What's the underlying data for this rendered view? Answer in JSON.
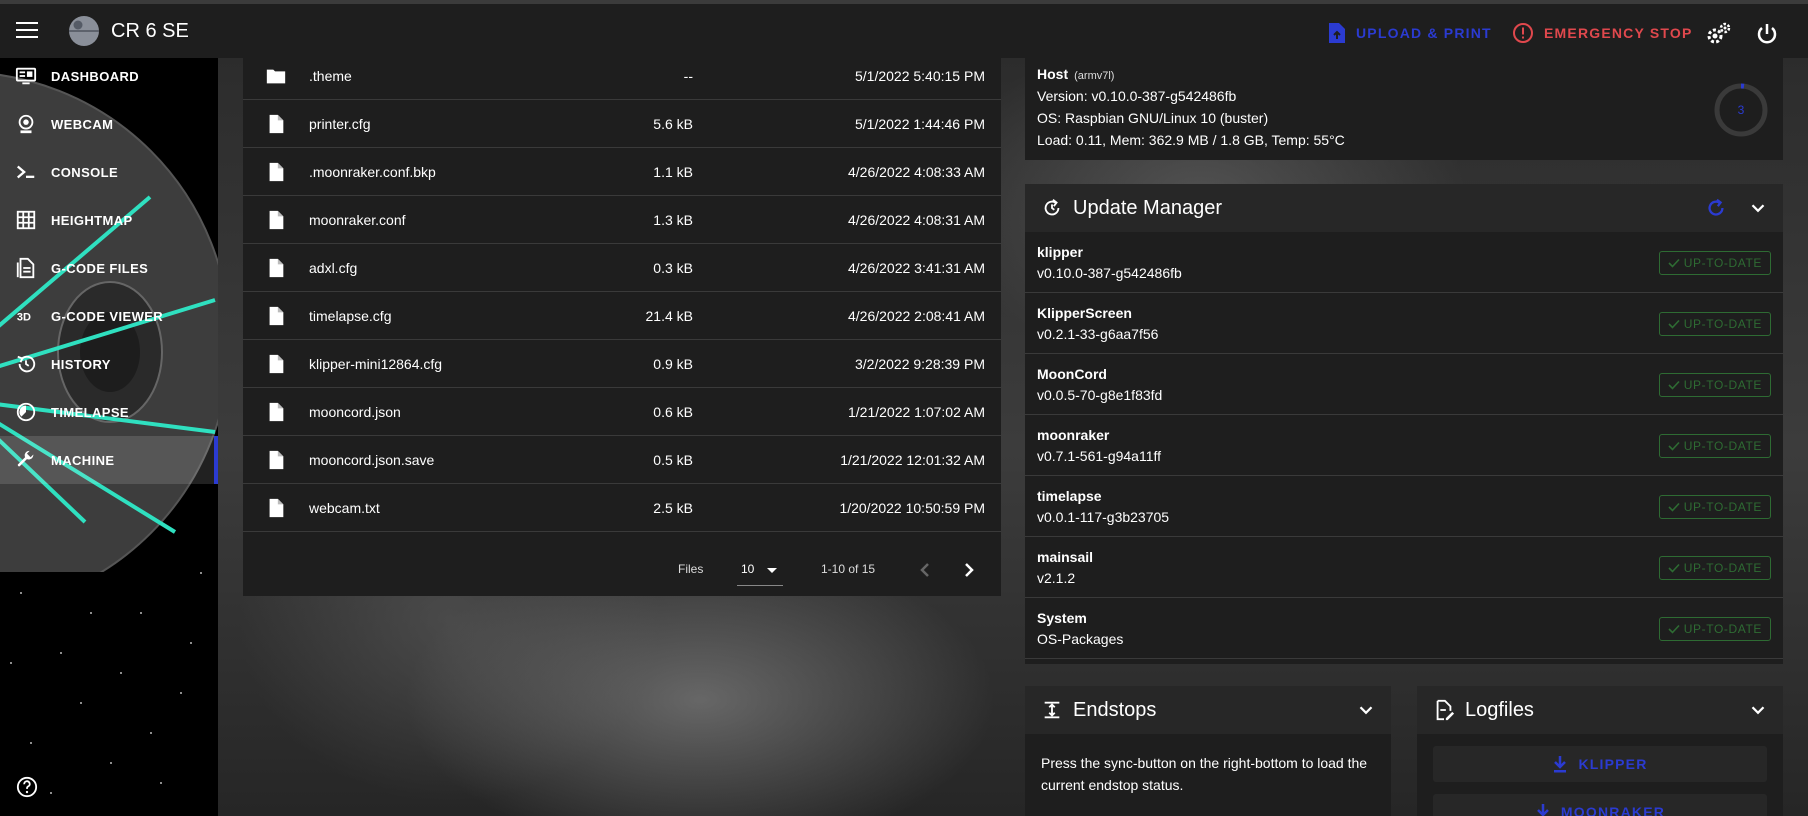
{
  "app": {
    "printer_name": "CR 6 SE"
  },
  "topbar": {
    "upload_print_label": "UPLOAD & PRINT",
    "emergency_stop_label": "EMERGENCY STOP"
  },
  "sidebar": {
    "items": [
      {
        "label": "DASHBOARD",
        "icon": "monitor-dashboard-icon"
      },
      {
        "label": "WEBCAM",
        "icon": "webcam-icon"
      },
      {
        "label": "CONSOLE",
        "icon": "console-icon"
      },
      {
        "label": "HEIGHTMAP",
        "icon": "grid-icon"
      },
      {
        "label": "G-CODE FILES",
        "icon": "file-document-icon"
      },
      {
        "label": "G-CODE VIEWER",
        "icon": "3d-icon"
      },
      {
        "label": "HISTORY",
        "icon": "history-icon"
      },
      {
        "label": "TIMELAPSE",
        "icon": "timelapse-icon"
      },
      {
        "label": "MACHINE",
        "icon": "wrench-icon",
        "active": true
      }
    ]
  },
  "files": {
    "rows": [
      {
        "name": ".theme",
        "size": "--",
        "modified": "5/1/2022 5:40:15 PM",
        "type": "folder"
      },
      {
        "name": "printer.cfg",
        "size": "5.6 kB",
        "modified": "5/1/2022 1:44:46 PM",
        "type": "file"
      },
      {
        "name": ".moonraker.conf.bkp",
        "size": "1.1 kB",
        "modified": "4/26/2022 4:08:33 AM",
        "type": "file"
      },
      {
        "name": "moonraker.conf",
        "size": "1.3 kB",
        "modified": "4/26/2022 4:08:31 AM",
        "type": "file"
      },
      {
        "name": "adxl.cfg",
        "size": "0.3 kB",
        "modified": "4/26/2022 3:41:31 AM",
        "type": "file"
      },
      {
        "name": "timelapse.cfg",
        "size": "21.4 kB",
        "modified": "4/26/2022 2:08:41 AM",
        "type": "file"
      },
      {
        "name": "klipper-mini12864.cfg",
        "size": "0.9 kB",
        "modified": "3/2/2022 9:28:39 PM",
        "type": "file"
      },
      {
        "name": "mooncord.json",
        "size": "0.6 kB",
        "modified": "1/21/2022 1:07:02 AM",
        "type": "file"
      },
      {
        "name": "mooncord.json.save",
        "size": "0.5 kB",
        "modified": "1/21/2022 12:01:32 AM",
        "type": "file"
      },
      {
        "name": "webcam.txt",
        "size": "2.5 kB",
        "modified": "1/20/2022 10:50:59 PM",
        "type": "file"
      }
    ],
    "pagination": {
      "label": "Files",
      "per_page": "10",
      "range": "1-10 of 15"
    }
  },
  "host": {
    "title": "Host",
    "arch": "(armv7l)",
    "version": "Version: v0.10.0-387-g542486fb",
    "os": "OS: Raspbian GNU/Linux 10 (buster)",
    "load": "Load: 0.11, Mem: 362.9 MB / 1.8 GB, Temp: 55°C",
    "gauge_value": "3"
  },
  "update_manager": {
    "title": "Update Manager",
    "status_label": "UP-TO-DATE",
    "items": [
      {
        "name": "klipper",
        "version": "v0.10.0-387-g542486fb"
      },
      {
        "name": "KlipperScreen",
        "version": "v0.2.1-33-g6aa7f56"
      },
      {
        "name": "MoonCord",
        "version": "v0.0.5-70-g8e1f83fd"
      },
      {
        "name": "moonraker",
        "version": "v0.7.1-561-g94a11ff"
      },
      {
        "name": "timelapse",
        "version": "v0.0.1-117-g3b23705"
      },
      {
        "name": "mainsail",
        "version": "v2.1.2"
      },
      {
        "name": "System",
        "version": "OS-Packages"
      }
    ]
  },
  "endstops": {
    "title": "Endstops",
    "message": "Press the sync-button on the right-bottom to load the current endstop status."
  },
  "logfiles": {
    "title": "Logfiles",
    "buttons": [
      "KLIPPER",
      "MOONRAKER"
    ]
  },
  "colors": {
    "accent": "#2b3bd1",
    "danger": "#e0484d",
    "success_outline": "#2e6b33",
    "card_bg": "#1e1e1e"
  }
}
